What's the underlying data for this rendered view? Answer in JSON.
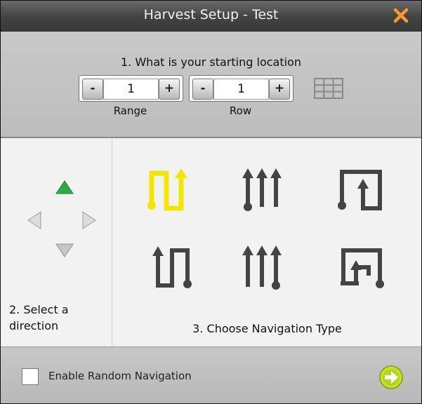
{
  "window": {
    "title": "Harvest Setup - Test",
    "close_icon": "close-icon",
    "accent_color": "#f79a2a"
  },
  "location": {
    "question": "1. What is your starting location",
    "range": {
      "label": "Range",
      "value": "1",
      "minus": "-",
      "plus": "+"
    },
    "row": {
      "label": "Row",
      "value": "1",
      "minus": "-",
      "plus": "+"
    },
    "grid_icon": "grid-icon"
  },
  "direction": {
    "label": "2. Select a direction",
    "arrows": [
      "up-arrow-icon",
      "left-arrow-icon",
      "right-arrow-icon",
      "down-arrow-icon"
    ],
    "selected": "up",
    "selected_color": "#2cab4a"
  },
  "navigation": {
    "label": "3. Choose Navigation Type",
    "selected_index": 0,
    "selected_color": "#f4e600",
    "icon_color": "#444444"
  },
  "footer": {
    "random_label": "Enable Random Navigation",
    "random_checked": false,
    "next_icon": "next-arrow-icon",
    "next_color": "#c8e22a"
  }
}
